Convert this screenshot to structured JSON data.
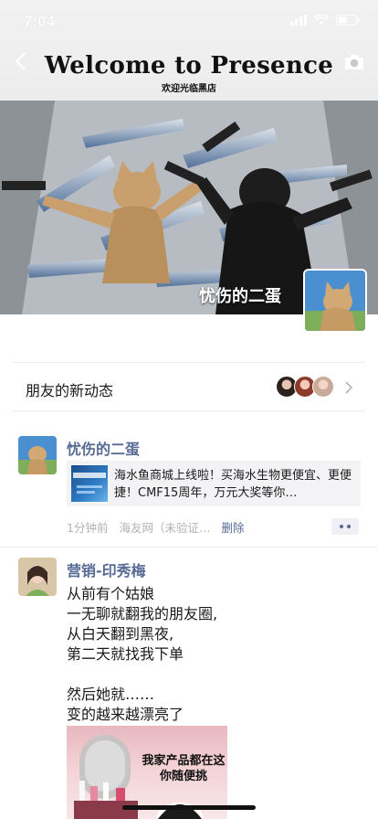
{
  "status_bar": {
    "time": "7:04"
  },
  "header": {
    "title": "Welcome to Presence",
    "subtitle": "欢迎光临黑店"
  },
  "cover": {
    "user_name": "忧伤的二蛋"
  },
  "activity": {
    "label": "朋友的新动态"
  },
  "posts": [
    {
      "author": "忧伤的二蛋",
      "link_text": "海水鱼商城上线啦！买海水生物更便宜、更便捷！CMF15周年，万元大奖等你…",
      "time": "1分钟前",
      "source": "海友网（未验证…",
      "delete_label": "删除"
    },
    {
      "author": "营销-印秀梅",
      "lines": [
        "从前有个姑娘",
        "一无聊就翻我的朋友圈,",
        "从白天翻到黑夜,",
        "第二天就找我下单",
        "",
        "然后她就……",
        "变的越来越漂亮了"
      ],
      "image_caption": [
        "我家产品都在这",
        "你随便挑"
      ]
    }
  ],
  "colors": {
    "link_blue": "#576b95",
    "meta_gray": "#b2b2b2"
  }
}
